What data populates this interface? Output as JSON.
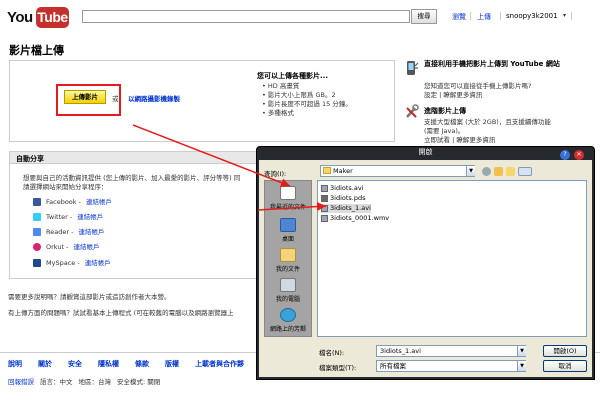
{
  "header": {
    "logo_you": "You",
    "logo_tube": "Tube",
    "search_button": "搜尋",
    "browse": "瀏覽",
    "upload": "上傳",
    "username": "snoopy3k2001",
    "user_caret": "▾"
  },
  "page_title": "影片檔上傳",
  "upload": {
    "button": "上傳影片",
    "or": "或",
    "record_link": "以網路攝影機錄製",
    "features_title": "您可以上傳各種影片...",
    "features": [
      "HD 高畫質",
      "影片大小上限爲 GB。2",
      "影片長度不可超過 15 分鐘。",
      "多種格式"
    ]
  },
  "mobile": {
    "title": "直接利用手機把影片上傳到 YouTube 網站",
    "desc": "您知道您可以直接從手機上傳影片嗎?",
    "links": "設定 | 瞭解更多資訊"
  },
  "advanced": {
    "title": "進階影片上傳",
    "desc1": "支援大型檔案 (大於 2GB)，且支援續傳功能",
    "desc2": "(需要 Java)。",
    "links": "立即試看 | 瞭解更多資訊"
  },
  "autoshare": {
    "title": "自動分享",
    "desc1": "想要與自己的活動資訊提供 (您上傳的影片、加入最愛的影片、評分等等) 同",
    "desc2": "請選擇網站來開始分享程序：",
    "connect_label": "連結帳戶",
    "networks": [
      {
        "name": "Facebook",
        "color": "#3b5998"
      },
      {
        "name": "Twitter",
        "color": "#33ccff"
      },
      {
        "name": "Reader",
        "color": "#4a8af4"
      },
      {
        "name": "Orkut",
        "color": "#d6246e"
      },
      {
        "name": "MySpace",
        "color": "#1d4a8c"
      }
    ]
  },
  "help": {
    "line1": "需要更多說明嗎？請觀賞這部影片或造訪創作者大本營。",
    "line2": "有上傳方面的問題嗎？試試看基本上傳程式 (可在較舊的電腦以及網路瀏覽器上"
  },
  "footer": {
    "links": [
      "說明",
      "關於",
      "安全",
      "隱私權",
      "條款",
      "版權",
      "上載者與合作夥"
    ],
    "bottom": [
      "回報錯誤",
      "語言：中文",
      "地區：台灣",
      "安全模式: 關閉"
    ]
  },
  "dialog": {
    "title": "開啟",
    "help_icon": "?",
    "close_icon": "✕",
    "lookin_label": "查詢(I):",
    "lookin_value": "Maker",
    "places": [
      "我最近的文件",
      "桌面",
      "我的文件",
      "我的電腦",
      "網路上的芳鄰"
    ],
    "files": [
      "3idiots.avi",
      "3idiots.pds",
      "3idiots_1.avi",
      "3idiots_0001.wmv"
    ],
    "filename_label": "檔名(N):",
    "filename_value": "3idiots_1.avi",
    "filetype_label": "檔案類型(T):",
    "filetype_value": "所有檔案",
    "open_button": "開啟(O)",
    "cancel_button": "取消"
  }
}
